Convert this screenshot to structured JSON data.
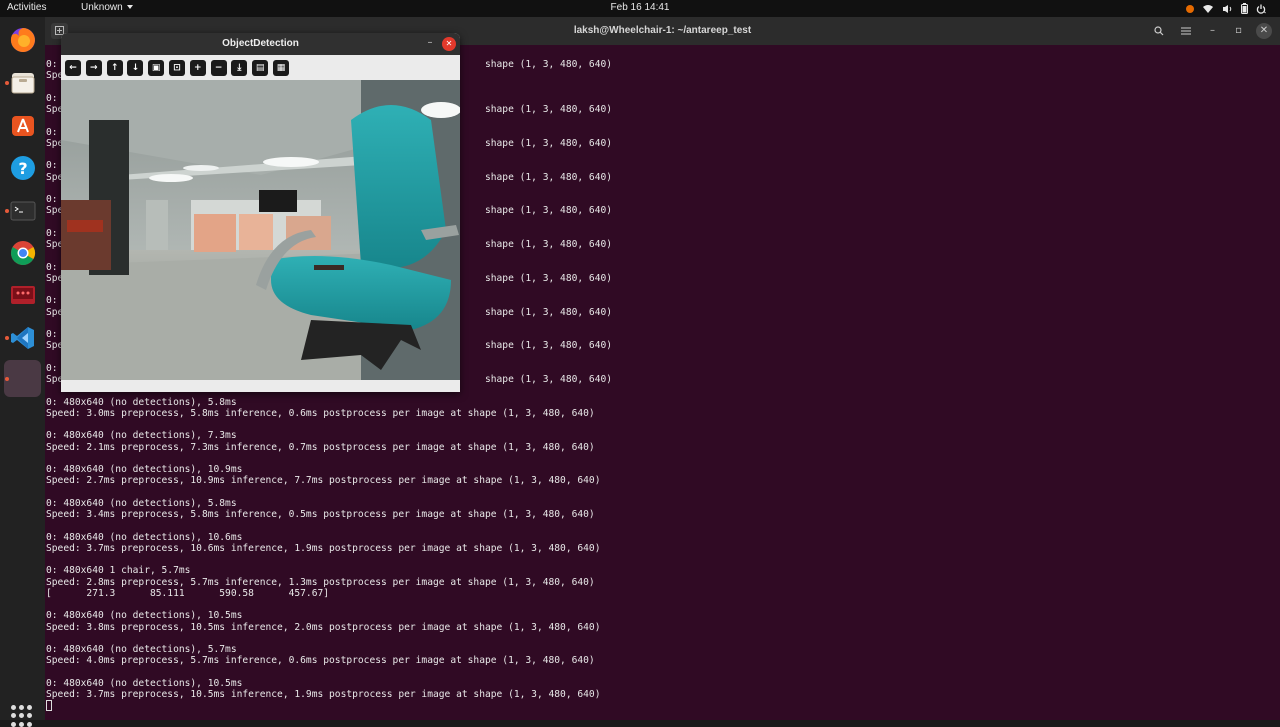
{
  "topbar": {
    "activities": "Activities",
    "app_menu": "Unknown",
    "clock": "Feb 16  14:41",
    "tray_icons": [
      "notification-dot-icon",
      "wifi-icon",
      "volume-icon",
      "battery-icon",
      "power-icon"
    ]
  },
  "dock": {
    "apps": [
      "firefox",
      "files",
      "app-center",
      "help",
      "terminal",
      "chrome",
      "screen-recorder",
      "vscode",
      "empty-slot"
    ]
  },
  "terminal": {
    "title": "laksh@Wheelchair-1: ~/antareep_test",
    "lines": [
      "0:                                                                          shape (1, 3, 480, 640)",
      "Spe",
      "",
      "0:",
      "Spe                                                                         shape (1, 3, 480, 640)",
      "",
      "0:",
      "Spe                                                                         shape (1, 3, 480, 640)",
      "",
      "0:",
      "Spe                                                                         shape (1, 3, 480, 640)",
      "",
      "0:",
      "Spe                                                                         shape (1, 3, 480, 640)",
      "",
      "0:",
      "Spe                                                                         shape (1, 3, 480, 640)",
      "",
      "0:",
      "Spe                                                                         shape (1, 3, 480, 640)",
      "",
      "0:",
      "Spe                                                                         shape (1, 3, 480, 640)",
      "",
      "0:",
      "Spe                                                                         shape (1, 3, 480, 640)",
      "",
      "0:",
      "Spe                                                                         shape (1, 3, 480, 640)",
      "",
      "0: 480x640 (no detections), 5.8ms",
      "Speed: 3.0ms preprocess, 5.8ms inference, 0.6ms postprocess per image at shape (1, 3, 480, 640)",
      "",
      "0: 480x640 (no detections), 7.3ms",
      "Speed: 2.1ms preprocess, 7.3ms inference, 0.7ms postprocess per image at shape (1, 3, 480, 640)",
      "",
      "0: 480x640 (no detections), 10.9ms",
      "Speed: 2.7ms preprocess, 10.9ms inference, 7.7ms postprocess per image at shape (1, 3, 480, 640)",
      "",
      "0: 480x640 (no detections), 5.8ms",
      "Speed: 3.4ms preprocess, 5.8ms inference, 0.5ms postprocess per image at shape (1, 3, 480, 640)",
      "",
      "0: 480x640 (no detections), 10.6ms",
      "Speed: 3.7ms preprocess, 10.6ms inference, 1.9ms postprocess per image at shape (1, 3, 480, 640)",
      "",
      "0: 480x640 1 chair, 5.7ms",
      "Speed: 2.8ms preprocess, 5.7ms inference, 1.3ms postprocess per image at shape (1, 3, 480, 640)",
      "[      271.3      85.111      590.58      457.67]",
      "",
      "0: 480x640 (no detections), 10.5ms",
      "Speed: 3.8ms preprocess, 10.5ms inference, 2.0ms postprocess per image at shape (1, 3, 480, 640)",
      "",
      "0: 480x640 (no detections), 5.7ms",
      "Speed: 4.0ms preprocess, 5.7ms inference, 0.6ms postprocess per image at shape (1, 3, 480, 640)",
      "",
      "0: 480x640 (no detections), 10.5ms",
      "Speed: 3.7ms preprocess, 10.5ms inference, 1.9ms postprocess per image at shape (1, 3, 480, 640)"
    ]
  },
  "od_window": {
    "title": "ObjectDetection",
    "toolbar": [
      {
        "name": "pan-left",
        "glyph": "←"
      },
      {
        "name": "pan-right",
        "glyph": "→"
      },
      {
        "name": "pan-up",
        "glyph": "↑"
      },
      {
        "name": "pan-down",
        "glyph": "↓"
      },
      {
        "name": "zoom-fit",
        "glyph": "▣"
      },
      {
        "name": "zoom-original",
        "glyph": "⊡"
      },
      {
        "name": "zoom-in",
        "glyph": "+"
      },
      {
        "name": "zoom-out",
        "glyph": "−"
      },
      {
        "name": "save-image",
        "glyph": "⤓"
      },
      {
        "name": "copy-image",
        "glyph": "▤"
      },
      {
        "name": "properties",
        "glyph": "▦"
      }
    ]
  },
  "colors": {
    "terminal_bg": "#300a24",
    "close_red": "#e2392c",
    "chair_teal": "#1f9aa0"
  }
}
